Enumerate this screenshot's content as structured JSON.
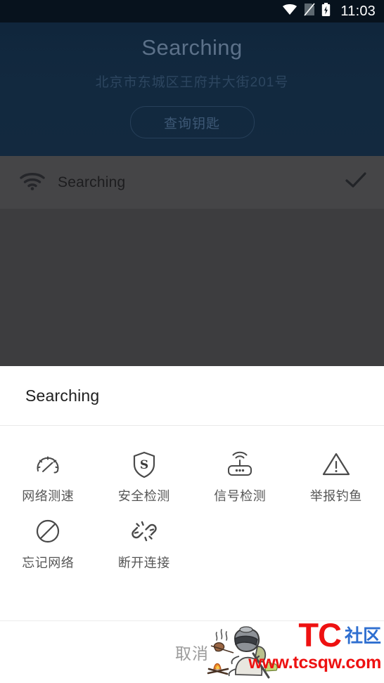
{
  "statusbar": {
    "time": "11:03",
    "icons": [
      "wifi-icon",
      "sim-off-icon",
      "battery-charging-icon"
    ]
  },
  "header": {
    "title": "Searching",
    "address": "北京市东城区王府井大街201号",
    "key_button_label": "查询钥匙",
    "background_color": "#12293f"
  },
  "wifi_list": {
    "rows": [
      {
        "ssid": "Searching",
        "icon": "wifi-icon",
        "connected": true,
        "status_icon": "check-icon"
      }
    ],
    "scrim_color": "#3d3d3f"
  },
  "sheet": {
    "title": "Searching",
    "actions": [
      {
        "label": "网络测速",
        "icon": "speedometer-icon"
      },
      {
        "label": "安全检测",
        "icon": "shield-s-icon"
      },
      {
        "label": "信号检测",
        "icon": "router-signal-icon"
      },
      {
        "label": "举报钓鱼",
        "icon": "warning-triangle-icon"
      },
      {
        "label": "忘记网络",
        "icon": "forbidden-icon"
      },
      {
        "label": "断开连接",
        "icon": "broken-link-icon"
      }
    ],
    "cancel_label": "取消"
  },
  "watermark": {
    "brand": "TC",
    "brand_suffix": "社区",
    "url": "www.tcsqw.com",
    "brand_color": "#ee1111",
    "suffix_color": "#2f6fd0"
  }
}
